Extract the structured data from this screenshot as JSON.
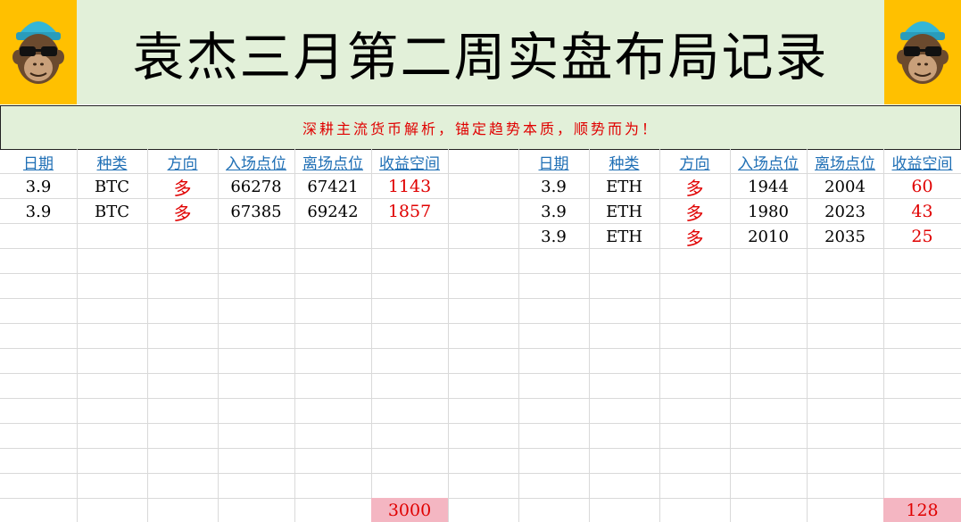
{
  "title": "袁杰三月第二周实盘布局记录",
  "slogan": "深耕主流货币解析，锚定趋势本质，顺势而为！",
  "headers": [
    "日期",
    "种类",
    "方向",
    "入场点位",
    "离场点位",
    "收益空间"
  ],
  "left_table": {
    "rows": [
      {
        "date": "3.9",
        "asset": "BTC",
        "direction": "多",
        "entry": "66278",
        "exit": "67421",
        "profit": "1143"
      },
      {
        "date": "3.9",
        "asset": "BTC",
        "direction": "多",
        "entry": "67385",
        "exit": "69242",
        "profit": "1857"
      }
    ],
    "total": "3000"
  },
  "right_table": {
    "rows": [
      {
        "date": "3.9",
        "asset": "ETH",
        "direction": "多",
        "entry": "1944",
        "exit": "2004",
        "profit": "60"
      },
      {
        "date": "3.9",
        "asset": "ETH",
        "direction": "多",
        "entry": "1980",
        "exit": "2023",
        "profit": "43"
      },
      {
        "date": "3.9",
        "asset": "ETH",
        "direction": "多",
        "entry": "2010",
        "exit": "2035",
        "profit": "25"
      }
    ],
    "total": "128"
  },
  "colors": {
    "header_bg": "#e2f0d9",
    "logo_bg": "#ffc000",
    "header_text": "#1f6fb5",
    "accent_red": "#e00000",
    "total_bg": "#f4b6c2"
  },
  "icons": {
    "logo": "monkey-with-sunglasses-icon"
  }
}
